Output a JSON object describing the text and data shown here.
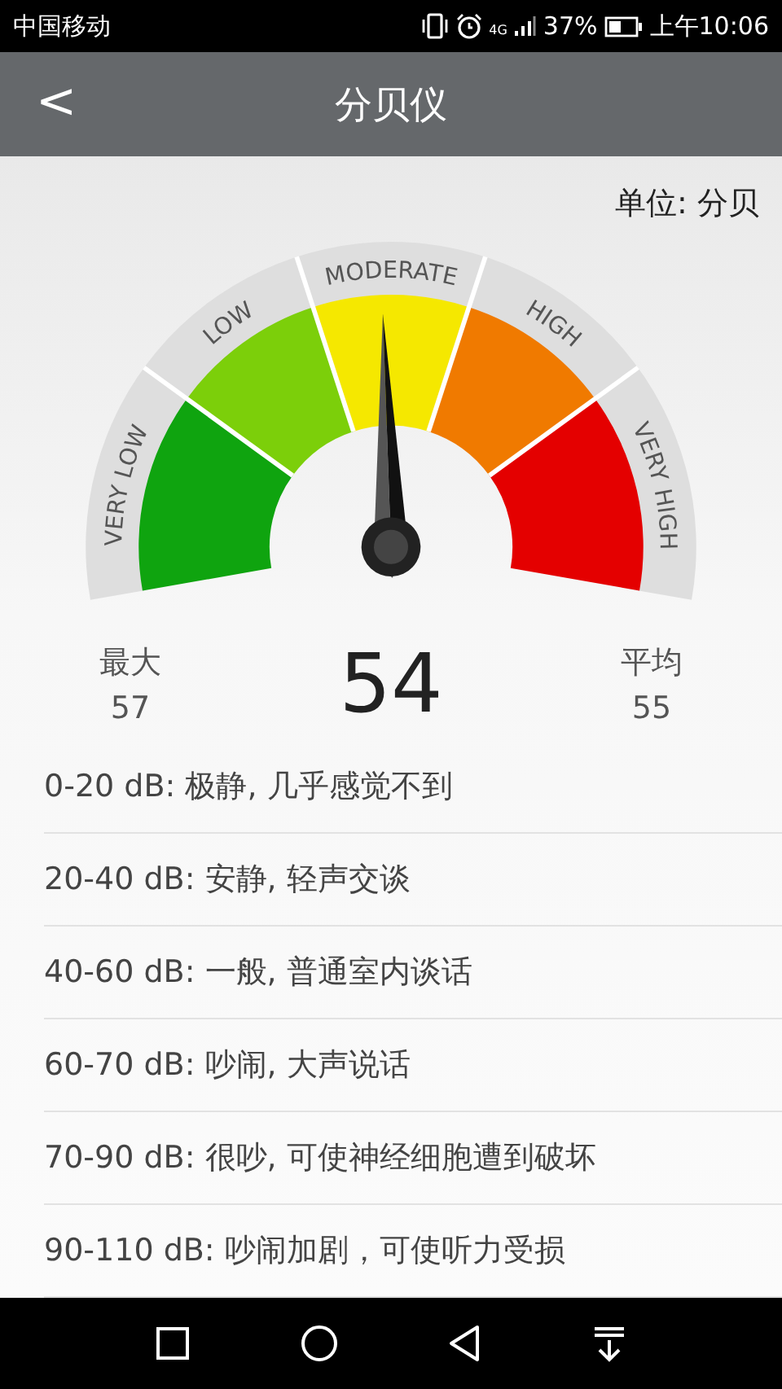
{
  "status_bar": {
    "carrier": "中国移动",
    "network": "4G",
    "battery": "37%",
    "time": "上午10:06"
  },
  "header": {
    "back": "<",
    "title": "分贝仪"
  },
  "unit": "单位: 分贝",
  "gauge": {
    "segments": [
      {
        "label": "VERY LOW",
        "color": "#0fa40f"
      },
      {
        "label": "LOW",
        "color": "#7ccf0a"
      },
      {
        "label": "MODERATE",
        "color": "#f5e800"
      },
      {
        "label": "HIGH",
        "color": "#f07a00"
      },
      {
        "label": "VERY HIGH",
        "color": "#e40000"
      }
    ]
  },
  "stats": {
    "max_label": "最大",
    "max": "57",
    "current": "54",
    "avg_label": "平均",
    "avg": "55"
  },
  "ranges": [
    "0-20 dB: 极静, 几乎感觉不到",
    "20-40 dB: 安静, 轻声交谈",
    "40-60 dB: 一般, 普通室内谈话",
    "60-70 dB: 吵闹, 大声说话",
    "70-90 dB: 很吵, 可使神经细胞遭到破坏",
    "90-110 dB: 吵闹加剧，可使听力受损"
  ]
}
